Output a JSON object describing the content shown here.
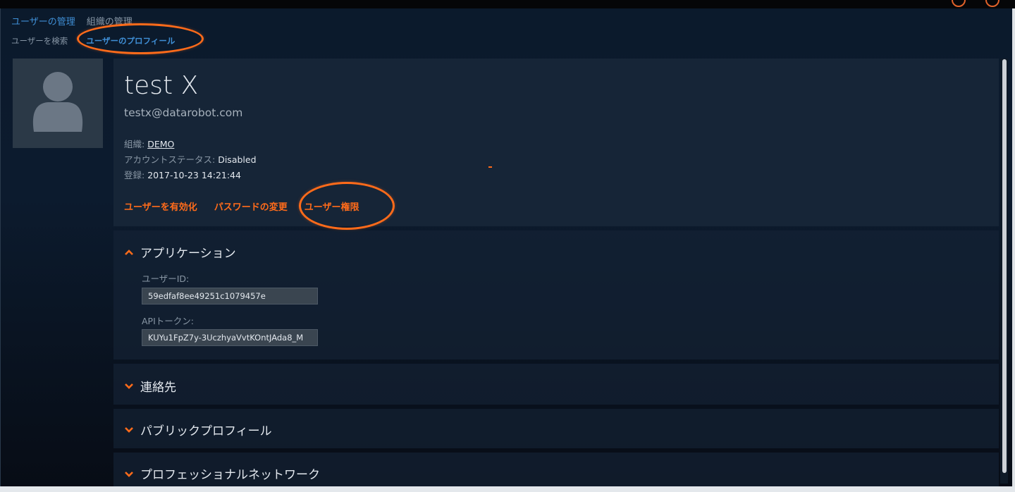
{
  "nav": {
    "primary": [
      "ユーザーの管理",
      "組織の管理"
    ],
    "secondary": [
      "ユーザーを検索",
      "ユーザーのプロフィール"
    ]
  },
  "profile": {
    "name": "test X",
    "email": "testx@datarobot.com",
    "org_label": "組織:",
    "org_value": "DEMO",
    "status_label": "アカウントステータス:",
    "status_value": "Disabled",
    "registered_label": "登録:",
    "registered_value": "2017-10-23 14:21:44"
  },
  "actions": [
    "ユーザーを有効化",
    "パスワードの変更",
    "ユーザー権限"
  ],
  "sections": {
    "application": {
      "title": "アプリケーション",
      "user_id_label": "ユーザーID:",
      "user_id_value": "59edfaf8ee49251c1079457e",
      "api_token_label": "APIトークン:",
      "api_token_value": "KUYu1FpZ7y-3UczhyaVvtKOntJAda8_M"
    },
    "contact": {
      "title": "連絡先"
    },
    "public_profile": {
      "title": "パブリックプロフィール"
    },
    "professional_network": {
      "title": "プロフェッショナルネットワーク"
    }
  },
  "colors": {
    "accent": "#ff6b1a",
    "link_active": "#3f8fd6",
    "background": "#0b1a2c"
  },
  "icons": {
    "avatar": "user-silhouette-icon",
    "section_expanded": "chevron-up-icon",
    "section_collapsed": "chevron-down-icon"
  }
}
